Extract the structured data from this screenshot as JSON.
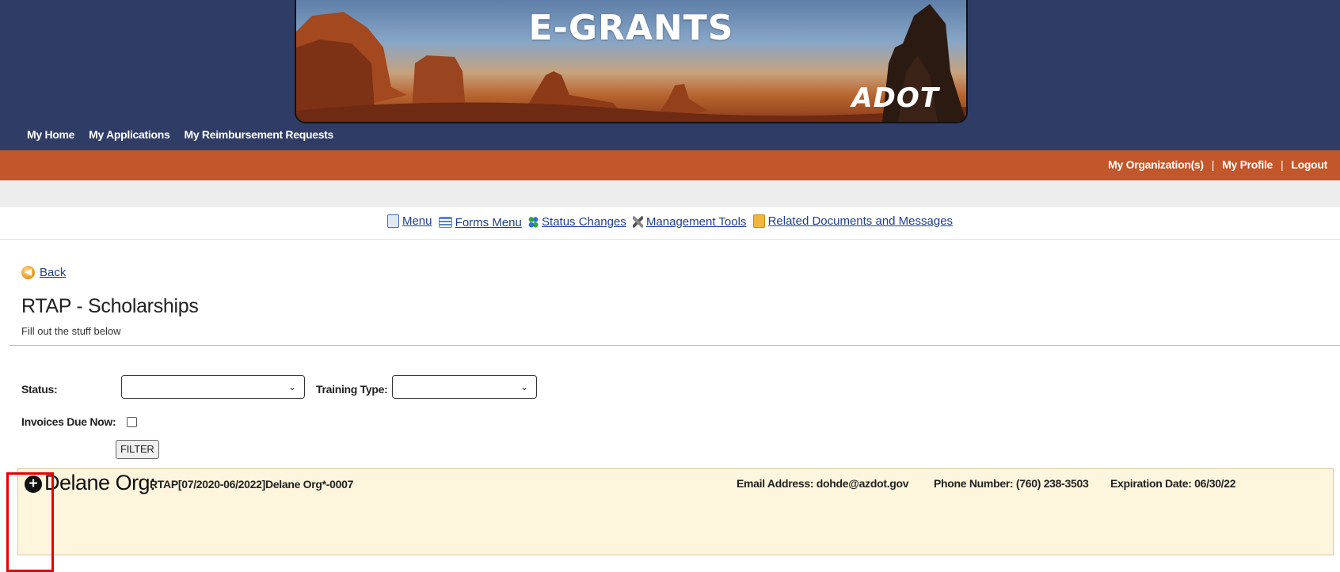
{
  "header": {
    "banner_title": "E-GRANTS",
    "banner_logo": "ADOT",
    "nav": [
      {
        "label": "My Home"
      },
      {
        "label": "My Applications"
      },
      {
        "label": "My Reimbursement Requests"
      }
    ],
    "user_nav": {
      "organizations": "My Organization(s)",
      "profile": "My Profile",
      "logout": "Logout",
      "separator": "|"
    }
  },
  "forms_menu": [
    {
      "label": "Menu",
      "icon": "menu-icon"
    },
    {
      "label": "Forms Menu",
      "icon": "forms-menu-icon"
    },
    {
      "label": "Status Changes",
      "icon": "status-changes-icon"
    },
    {
      "label": "Management Tools",
      "icon": "tools-icon"
    },
    {
      "label": "Related Documents and Messages",
      "icon": "folder-icon"
    }
  ],
  "page": {
    "back_label": "Back",
    "title": "RTAP - Scholarships",
    "subtitle": "Fill out the stuff below"
  },
  "filters": {
    "status_label": "Status:",
    "status_value": "",
    "training_type_label": "Training Type:",
    "training_type_value": "",
    "invoices_due_label": "Invoices Due Now:",
    "invoices_due_checked": false,
    "filter_button": "FILTER"
  },
  "org": {
    "expand_icon": "+",
    "name": "Delane Org:",
    "reference": "RTAP[07/2020-06/2022]Delane Org*-0007",
    "email": "Email Address: dohde@azdot.gov",
    "phone": "Phone Number: (760) 238-3503",
    "expiration": "Expiration Date: 06/30/22"
  },
  "colors": {
    "header_bg": "#2f3c66",
    "orange_bar": "#c1572a",
    "org_row_bg": "#fdf5dc",
    "highlight": "#e60000"
  }
}
